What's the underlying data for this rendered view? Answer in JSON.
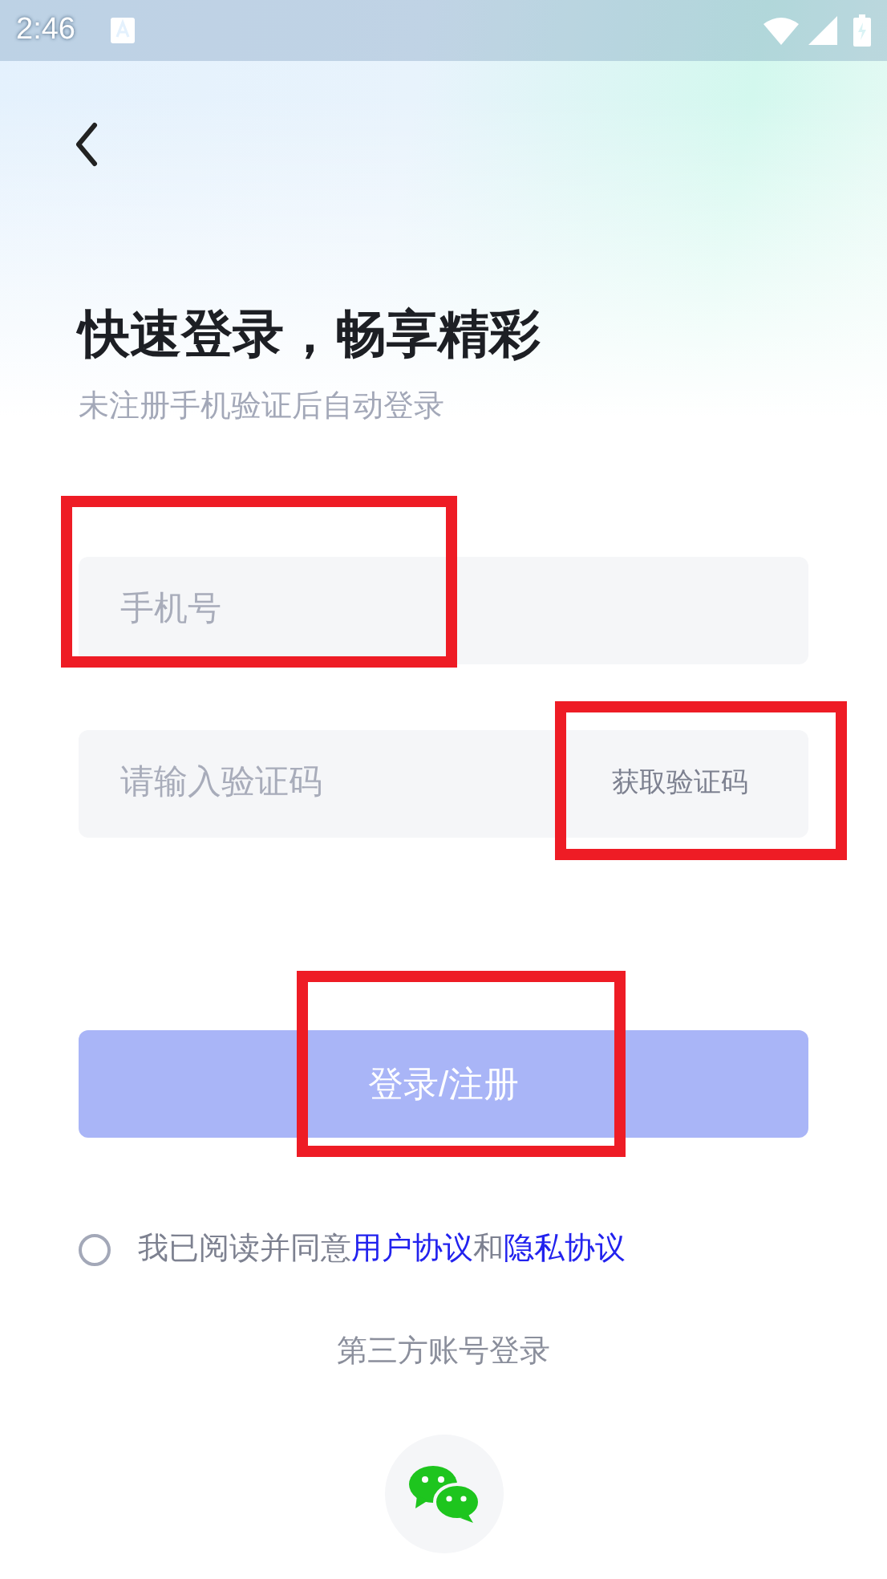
{
  "status_bar": {
    "time": "2:46"
  },
  "title": "快速登录，畅享精彩",
  "subtitle": "未注册手机验证后自动登录",
  "phone": {
    "placeholder": "手机号",
    "highlighted": true
  },
  "code": {
    "placeholder": "请输入验证码",
    "button": "获取验证码",
    "button_highlighted": true
  },
  "login_button": {
    "label": "登录/注册",
    "disabled": true,
    "highlighted": true
  },
  "agreement": {
    "checked": false,
    "prefix": "我已阅读并同意",
    "link_1": "用户协议",
    "joiner": "和",
    "link_2": "隐私协议"
  },
  "third_party": {
    "label": "第三方账号登录"
  }
}
